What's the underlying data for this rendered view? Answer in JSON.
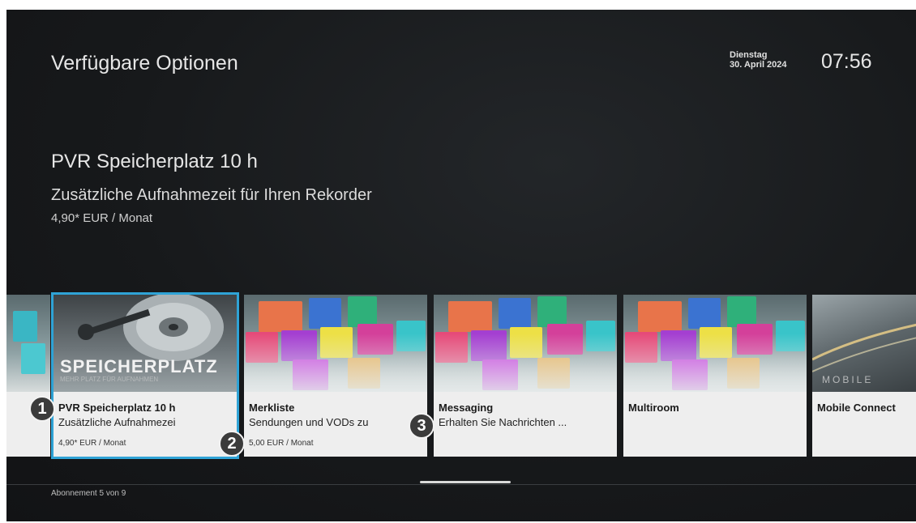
{
  "header": {
    "title": "Verfügbare Optionen",
    "weekday": "Dienstag",
    "date": "30. April 2024",
    "time": "07:56"
  },
  "detail": {
    "title": "PVR Speicherplatz 10 h",
    "description": "Zusätzliche Aufnahmezeit für Ihren Rekorder",
    "price": "4,90* EUR / Monat"
  },
  "cards": [
    {
      "name": "PVR Speicherplatz 10 h",
      "sub": "Zusätzliche Aufnahmezei",
      "price": "4,90* EUR / Monat",
      "image_text": "SPEICHERPLATZ",
      "image_subtext": "MEHR PLATZ FÜR AUFNAHMEN",
      "focused": true
    },
    {
      "name": "Merkliste",
      "sub": "Sendungen und VODs zu",
      "price": "5,00 EUR / Monat"
    },
    {
      "name": "Messaging",
      "sub": "Erhalten Sie Nachrichten ...",
      "price": ""
    },
    {
      "name": "Multiroom",
      "sub": "",
      "price": ""
    },
    {
      "name": "Mobile Connect",
      "sub": "",
      "price": "",
      "image_text": "MOBILE"
    }
  ],
  "badges": [
    "1",
    "2",
    "3"
  ],
  "footer": {
    "subscription_count": "Abonnement 5 von 9"
  },
  "colors": {
    "focus": "#2fa3d6",
    "background": "#17191b"
  }
}
